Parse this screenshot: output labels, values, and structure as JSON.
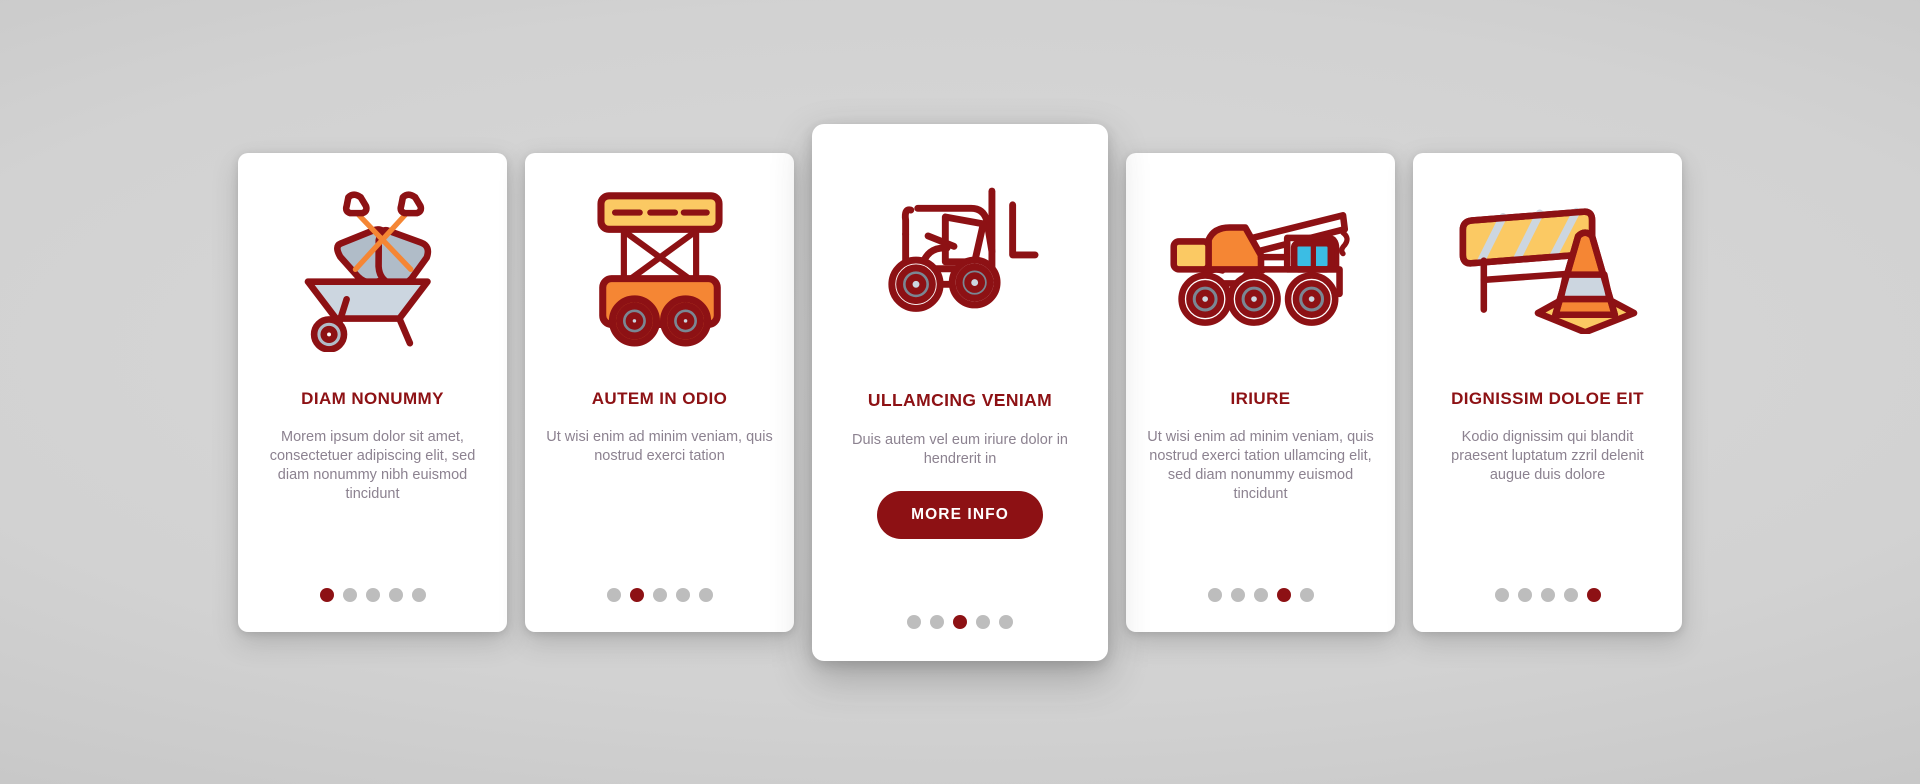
{
  "theme": {
    "background": "#d2d2d2",
    "card_background": "#ffffff",
    "accent_red": "#8d1114",
    "body_text": "#8c8290",
    "dot_inactive": "#bdbdbd",
    "icon_orange": "#f58634",
    "icon_yellow": "#fbc963",
    "icon_gray": "#b0bcc8",
    "icon_blue": "#3bbde4"
  },
  "cards": [
    {
      "icon": "wheelbarrow-shovels-icon",
      "title": "DIAM NONUMMY",
      "body": "Morem ipsum dolor sit amet, consectetuer adipiscing elit, sed diam nonummy nibh euismod tincidunt",
      "dots": 5,
      "active_dot": 0,
      "featured": false
    },
    {
      "icon": "scissor-lift-icon",
      "title": "AUTEM IN ODIO",
      "body": "Ut wisi enim ad minim veniam, quis nostrud exerci tation",
      "dots": 5,
      "active_dot": 1,
      "featured": false
    },
    {
      "icon": "forklift-icon",
      "title": "ULLAMCING VENIAM",
      "body": "Duis autem vel eum iriure dolor in hendrerit in",
      "button_label": "MORE INFO",
      "dots": 5,
      "active_dot": 2,
      "featured": true
    },
    {
      "icon": "crane-truck-icon",
      "title": "IRIURE",
      "body": "Ut wisi enim ad minim veniam, quis nostrud exerci tation ullamcing elit, sed diam nonummy euismod tincidunt",
      "dots": 5,
      "active_dot": 3,
      "featured": false
    },
    {
      "icon": "barrier-cone-icon",
      "title": "DIGNISSIM DOLOE EIT",
      "body": "Kodio dignissim qui blandit praesent luptatum zzril delenit augue duis dolore",
      "dots": 5,
      "active_dot": 4,
      "featured": false
    }
  ]
}
